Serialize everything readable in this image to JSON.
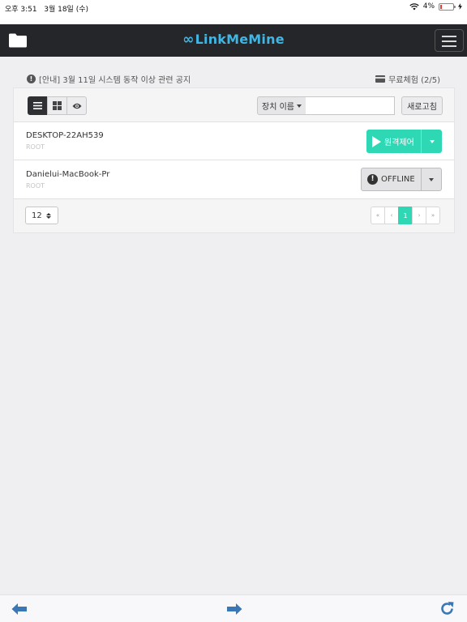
{
  "status": {
    "time": "오후 3:51",
    "date": "3월 18일 (수)",
    "battery": "4%"
  },
  "header": {
    "logo_symbol": "∞",
    "logo_text": "LinkMeMine"
  },
  "notice": {
    "text": "[안내] 3월 11일 시스템 동작 이상 관련 공지",
    "trial": "무료체험 (2/5)"
  },
  "toolbar": {
    "filter_label": "장치 이름",
    "search_value": "",
    "refresh_label": "새로고침"
  },
  "devices": [
    {
      "name": "DESKTOP-22AH539",
      "sub": "ROOT",
      "action": "원격제어"
    },
    {
      "name": "Danielui-MacBook-Pr",
      "sub": "ROOT",
      "action": "OFFLINE"
    }
  ],
  "pagination": {
    "page_size": "12",
    "first": "«",
    "prev": "‹",
    "current": "1",
    "next": "›",
    "last": "»"
  },
  "colors": {
    "accent": "#2ed8b5",
    "logo": "#3fb6e3",
    "navbar": "#25262a",
    "nav_arrow": "#3a78b5"
  }
}
